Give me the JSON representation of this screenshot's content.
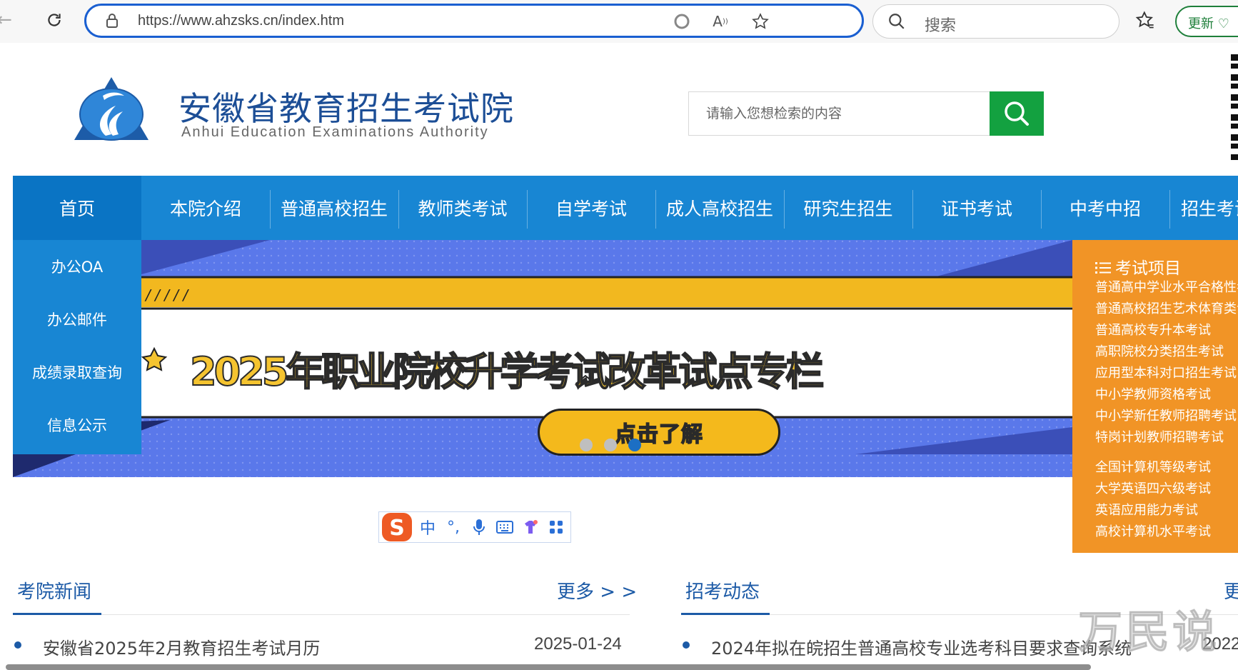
{
  "browser": {
    "url": "https://www.ahzsks.cn/index.htm",
    "search_placeholder": "搜索",
    "update_label": "更新"
  },
  "header": {
    "title": "安徽省教育招生考试院",
    "subtitle": "Anhui Education Examinations Authority",
    "search_placeholder": "请输入您想检索的内容"
  },
  "nav": {
    "items": [
      "首页",
      "本院介绍",
      "普通高校招生",
      "教师类考试",
      "自学考试",
      "成人高校招生",
      "研究生招生",
      "证书考试",
      "中考中招",
      "招生考试"
    ]
  },
  "side_menu": {
    "items": [
      "办公OA",
      "办公邮件",
      "成绩录取查询",
      "信息公示"
    ]
  },
  "banner": {
    "headline": "2025年职业院校升学考试改革试点专栏",
    "cta": "点击了解",
    "active_slide": 3,
    "slide_count": 3
  },
  "exam_panel": {
    "title": "考试项目",
    "links": [
      "普通高中学业水平合格性考试",
      "普通高校招生艺术体育类专业考试",
      "普通高校专升本考试",
      "高职院校分类招生考试",
      "应用型本科对口招生考试",
      "中小学教师资格考试",
      "中小学新任教师招聘考试",
      "特岗计划教师招聘考试",
      "全国计算机等级考试",
      "大学英语四六级考试",
      "英语应用能力考试",
      "高校计算机水平考试"
    ]
  },
  "ime": {
    "mode_label": "中"
  },
  "news_left": {
    "title": "考院新闻",
    "more": "更多 > >",
    "items": [
      {
        "text": "安徽省2025年2月教育招生考试月历",
        "date": "2025-01-24"
      }
    ]
  },
  "news_right": {
    "title": "招考动态",
    "more": "更",
    "items": [
      {
        "text": "2024年拟在皖招生普通高校专业选考科目要求查询系统",
        "date": "2022"
      }
    ]
  },
  "watermark": "万民说",
  "colors": {
    "primary_blue": "#1886d3",
    "home_blue": "#0a74c4",
    "title_blue": "#1c4e96",
    "search_green": "#13a140",
    "panel_orange": "#f19426",
    "banner_yellow": "#f5c430"
  }
}
